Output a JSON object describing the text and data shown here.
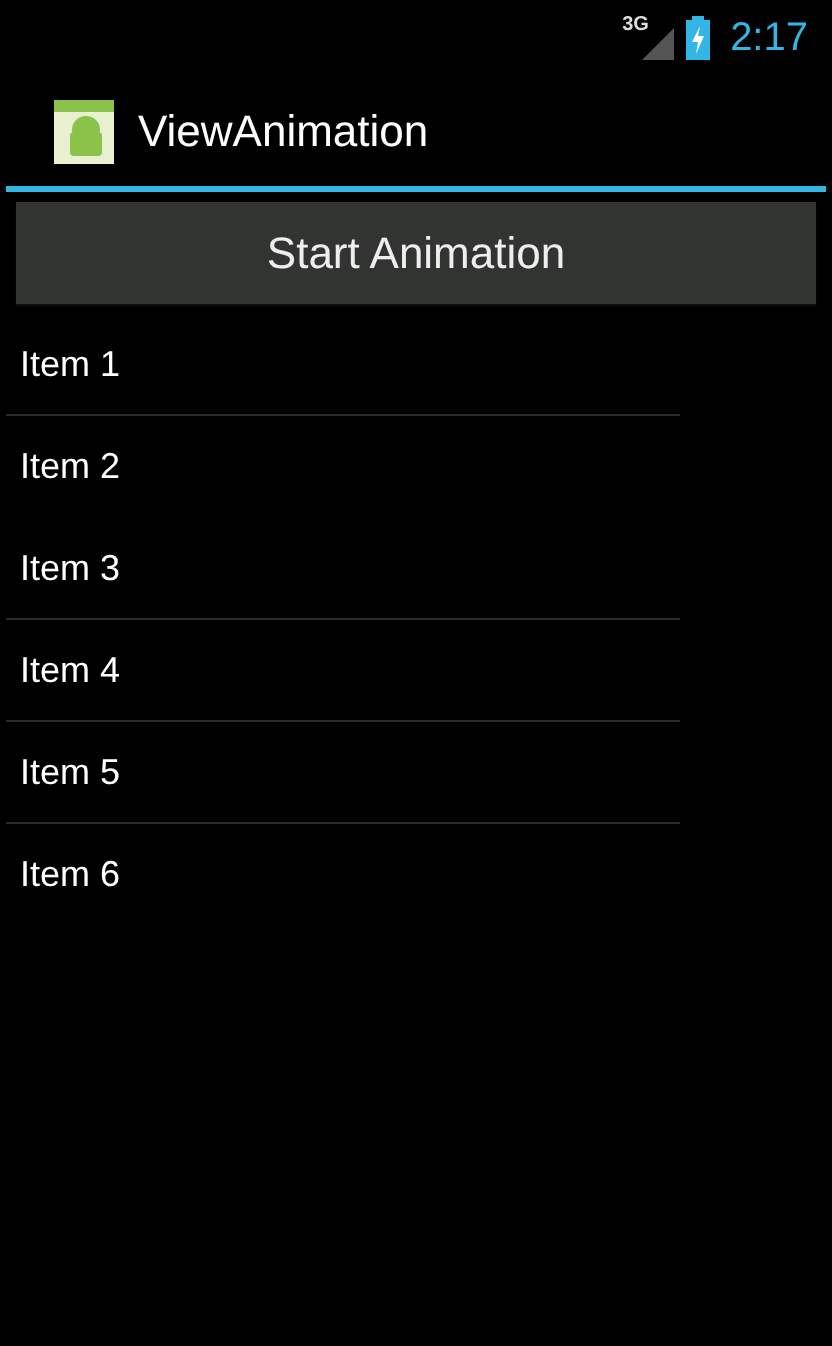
{
  "status_bar": {
    "network": "3G",
    "time": "2:17"
  },
  "action_bar": {
    "title": "ViewAnimation"
  },
  "button": {
    "label": "Start Animation"
  },
  "list": [
    {
      "label": "Item 1",
      "divider_below": true
    },
    {
      "label": "Item 2",
      "divider_below": false
    },
    {
      "label": "Item 3",
      "divider_below": true
    },
    {
      "label": "Item 4",
      "divider_below": true
    },
    {
      "label": "Item 5",
      "divider_below": true
    },
    {
      "label": "Item 6",
      "divider_below": false
    }
  ]
}
